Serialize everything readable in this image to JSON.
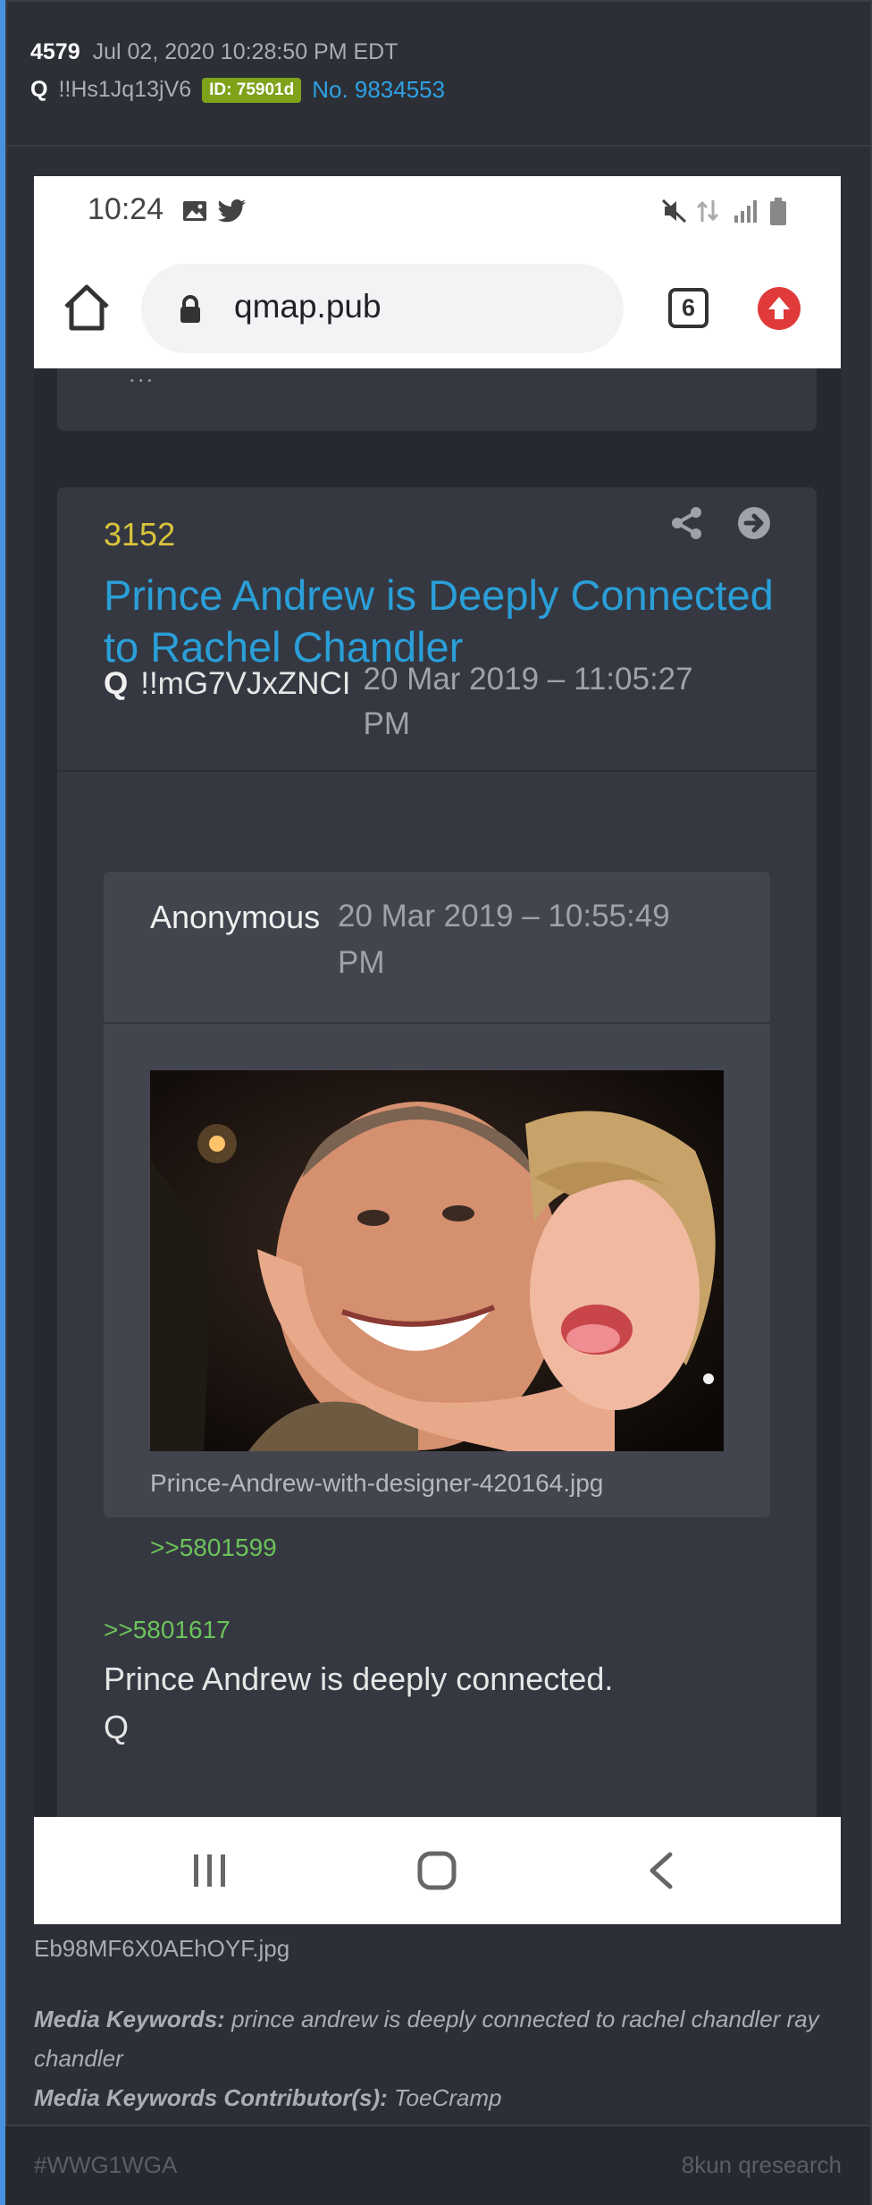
{
  "post": {
    "number": "4579",
    "datetime": "Jul 02, 2020 10:28:50 PM EDT",
    "author": "Q",
    "tripcode": "!!Hs1Jq13jV6",
    "id_badge": "ID: 75901d",
    "post_no": "No. 9834553"
  },
  "phone": {
    "status_time": "10:24",
    "url": "qmap.pub",
    "tab_count": "6",
    "prev_card_fragment": "...",
    "card": {
      "number": "3152",
      "title": "Prince Andrew is Deeply Connected to Rachel Chandler",
      "author": "Q",
      "tripcode": "!!mG7VJxZNCI",
      "date": "20 Mar 2019 – 11:05:27 PM",
      "quote": {
        "author": "Anonymous",
        "date": "20 Mar 2019 – 10:55:49 PM",
        "image_filename": "Prince-Andrew-with-designer-420164.jpg",
        "reply_link": ">>5801599"
      },
      "reply_link": ">>5801617",
      "text_line1": "Prince Andrew is deeply connected.",
      "text_line2": "Q"
    }
  },
  "media": {
    "filename": "Eb98MF6X0AEhOYF.jpg",
    "keywords_label": "Media Keywords:",
    "keywords": "prince andrew is deeply connected to rachel chandler ray chandler",
    "contributors_label": "Media Keywords Contributor(s):",
    "contributors": "ToeCramp"
  },
  "footer": {
    "hashtag": "#WWG1WGA",
    "board": "8kun qresearch"
  },
  "colors": {
    "background": "#2c2f36",
    "accent_left": "#4a90e2",
    "badge": "#7ea21a",
    "link_blue": "#2ea1e4",
    "title_blue": "#2a9fd8",
    "number_yellow": "#d9c33a",
    "reply_green": "#6cc35a"
  }
}
